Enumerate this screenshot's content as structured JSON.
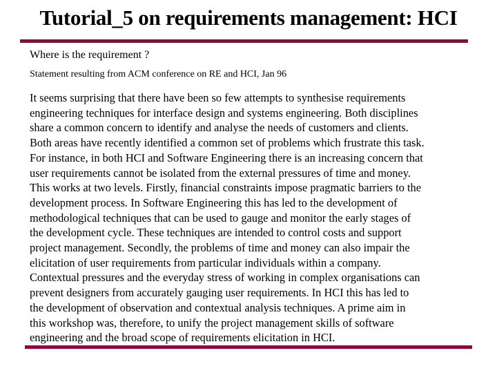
{
  "slide": {
    "title": "Tutorial_5 on requirements management: HCI",
    "accent_color": "#8C0B3C",
    "heading": "Where is the requirement  ?",
    "subheading": "Statement resulting from ACM conference on RE and HCI, Jan 96",
    "body_lines": [
      "It seems surprising that there have been so few attempts to synthesise requirements",
      "engineering techniques for interface design and systems engineering. Both disciplines",
      "share a common concern to identify and analyse the needs of customers and clients.",
      "Both areas have recently identified a common set of problems which frustrate this task.",
      "For instance, in both HCI and Software Engineering there is an increasing concern that",
      "user requirements cannot be isolated from the external pressures of time and money.",
      "This works at two levels. Firstly, financial constraints impose pragmatic barriers to the",
      "development process. In Software Engineering this has led to the development of",
      "methodological techniques that can be used to gauge and monitor the early stages of",
      "the development cycle. These techniques are intended to control costs and support",
      "project management. Secondly, the problems of time and money can also impair the",
      "elicitation of user requirements from particular individuals within a company.",
      "Contextual pressures and the everyday stress of working in complex organisations can",
      "prevent designers from accurately gauging user requirements. In HCI this has led to",
      "the development of observation and contextual analysis techniques. A prime aim in",
      "this workshop was, therefore, to unify the project management skills of software",
      "engineering and the broad scope of requirements elicitation in HCI."
    ]
  }
}
